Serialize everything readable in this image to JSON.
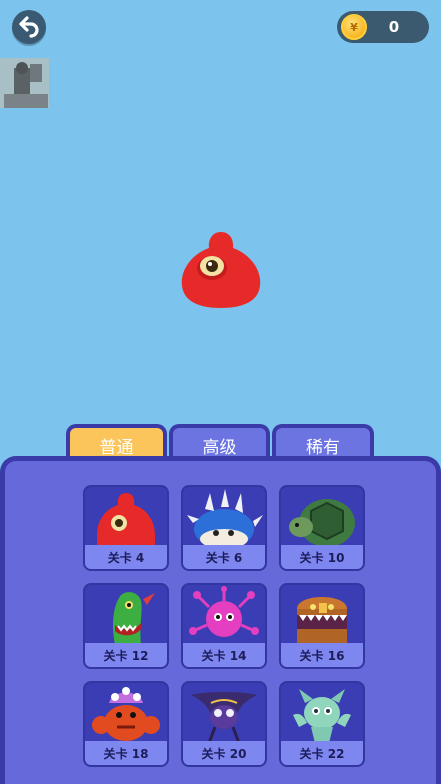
{
  "coins": {
    "count": "0",
    "symbol": "¥"
  },
  "tabs": [
    {
      "label": "普通",
      "active": true
    },
    {
      "label": "高级",
      "active": false
    },
    {
      "label": "稀有",
      "active": false
    }
  ],
  "cards": [
    {
      "label": "关卡 4",
      "monster": "red-blob"
    },
    {
      "label": "关卡 6",
      "monster": "spiked-shell"
    },
    {
      "label": "关卡 10",
      "monster": "turtle"
    },
    {
      "label": "关卡 12",
      "monster": "green-plant"
    },
    {
      "label": "关卡 14",
      "monster": "pink-virus"
    },
    {
      "label": "关卡 16",
      "monster": "treasure-chest"
    },
    {
      "label": "关卡 18",
      "monster": "red-crab"
    },
    {
      "label": "关卡 20",
      "monster": "purple-bat"
    },
    {
      "label": "关卡 22",
      "monster": "teal-ghost"
    }
  ],
  "colors": {
    "sky": "#7cc4ee",
    "panel": "#6569d9",
    "panel_border": "#3a3aa8",
    "tab_active": "#fcc55c",
    "tab_inactive": "#6b74e0"
  }
}
